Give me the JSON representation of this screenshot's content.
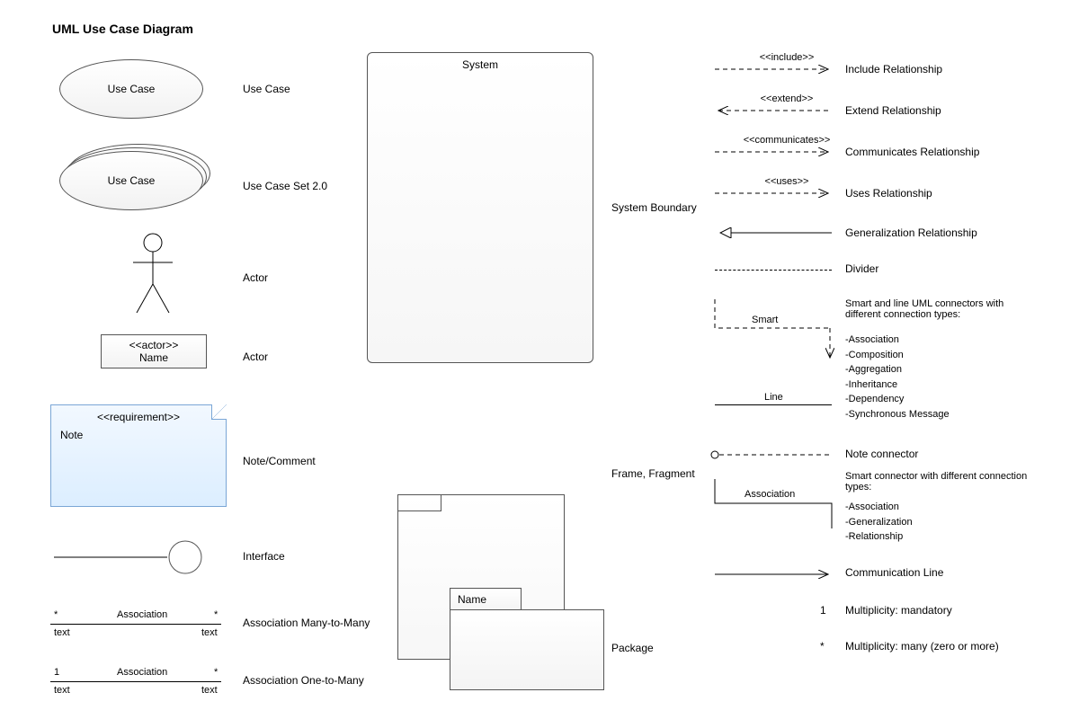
{
  "title": "UML Use Case Diagram",
  "left": {
    "usecase": {
      "text": "Use Case",
      "label": "Use Case"
    },
    "usecaseset": {
      "text": "Use Case",
      "label": "Use Case Set 2.0"
    },
    "actor_stick": {
      "label": "Actor"
    },
    "actor_box": {
      "stereo": "<<actor>>",
      "name": "Name",
      "label": "Actor"
    },
    "note": {
      "stereo": "<<requirement>>",
      "text": "Note",
      "label": "Note/Comment"
    },
    "interface": {
      "label": "Interface"
    },
    "assoc_mm": {
      "left": "*",
      "right": "*",
      "mid": "Association",
      "tl": "text",
      "tr": "text",
      "label": "Association Many-to-Many"
    },
    "assoc_om": {
      "left": "1",
      "right": "*",
      "mid": "Association",
      "tl": "text",
      "tr": "text",
      "label": "Association One-to-Many"
    }
  },
  "center": {
    "system": {
      "title": "System",
      "label": "System Boundary"
    },
    "frame": {
      "label": "Frame, Fragment"
    },
    "package": {
      "tab": "Name",
      "label": "Package"
    }
  },
  "right": {
    "include": {
      "text": "<<include>>",
      "label": "Include Relationship"
    },
    "extend": {
      "text": "<<extend>>",
      "label": "Extend Relationship"
    },
    "communicates": {
      "text": "<<communicates>>",
      "label": "Communicates Relationship"
    },
    "uses": {
      "text": "<<uses>>",
      "label": "Uses Relationship"
    },
    "generalization": {
      "label": "Generalization Relationship"
    },
    "divider": {
      "label": "Divider"
    },
    "smart": {
      "label": "Smart",
      "line": "Line",
      "desc": "Smart and line UML connectors with different connection types:",
      "types": [
        "-Association",
        "-Composition",
        "-Aggregation",
        "-Inheritance",
        "-Dependency",
        "-Synchronous Message"
      ]
    },
    "noteconn": {
      "label": "Note connector"
    },
    "assoc_conn": {
      "label": "Association",
      "desc": "Smart connector with different connection types:",
      "types": [
        "-Association",
        "-Generalization",
        "-Relationship"
      ]
    },
    "commline": {
      "label": "Communication Line"
    },
    "mult1": {
      "sym": "1",
      "label": "Multiplicity: mandatory"
    },
    "multn": {
      "sym": "*",
      "label": "Multiplicity: many (zero or more)"
    }
  }
}
